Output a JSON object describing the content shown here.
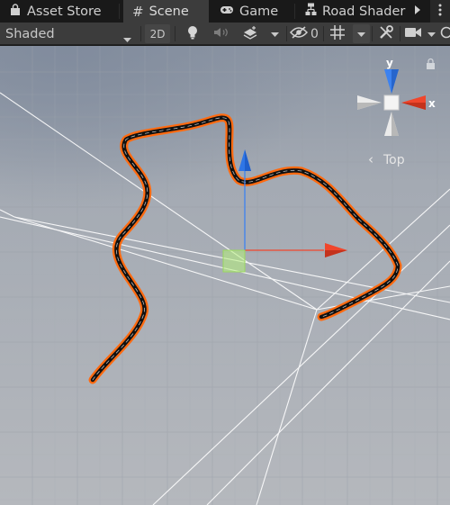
{
  "tabs": [
    {
      "label": "Asset Store",
      "icon": "bag-icon"
    },
    {
      "label": "Scene",
      "icon": "grid-icon"
    },
    {
      "label": "Game",
      "icon": "gamepad-icon"
    },
    {
      "label": "Road Shader",
      "icon": "node-graph-icon"
    }
  ],
  "toolbar": {
    "shading_mode": "Shaded",
    "toggle_2d": "2D",
    "hidden_count": "0"
  },
  "gizmo": {
    "axis_y": "y",
    "axis_x": "x",
    "view_label": "Top"
  },
  "colors": {
    "road_outline": "#ff6a10",
    "road_core": "#111111",
    "axis_x": "#f0462c",
    "axis_y": "#3c82f0",
    "selected_handle": "#b4f07a"
  }
}
